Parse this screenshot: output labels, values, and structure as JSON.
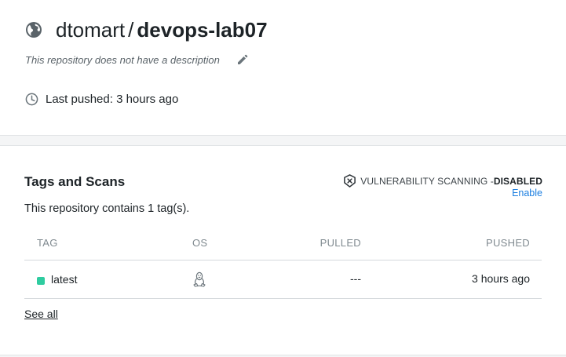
{
  "repo": {
    "namespace": "dtomart",
    "separator": "/",
    "name": "devops-lab07",
    "description": "This repository does not have a description",
    "last_pushed": "Last pushed: 3 hours ago"
  },
  "tags_section": {
    "title": "Tags and Scans",
    "summary": "This repository contains 1 tag(s).",
    "vuln_label": "VULNERABILITY SCANNING - ",
    "vuln_status": "DISABLED",
    "enable_label": "Enable",
    "columns": [
      "TAG",
      "OS",
      "PULLED",
      "PUSHED"
    ],
    "rows": [
      {
        "tag": "latest",
        "os": "linux-icon",
        "pulled": "---",
        "pushed": "3 hours ago"
      }
    ],
    "see_all": "See all"
  },
  "colors": {
    "link": "#1b7ee0",
    "status_dot": "#2fcca0"
  }
}
